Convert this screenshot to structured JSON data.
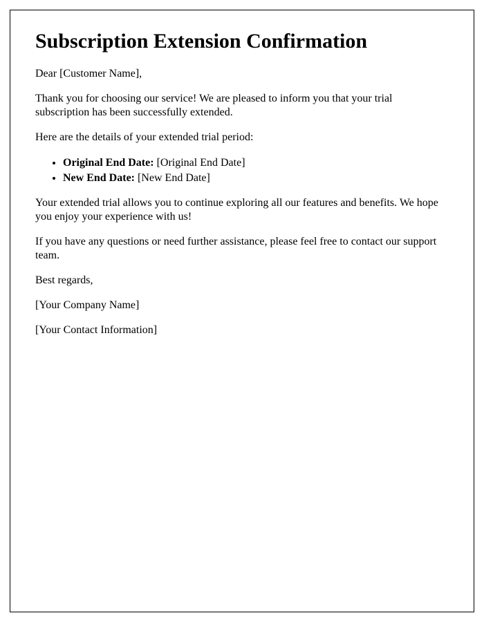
{
  "title": "Subscription Extension Confirmation",
  "greeting": "Dear [Customer Name],",
  "para1": "Thank you for choosing our service! We are pleased to inform you that your trial subscription has been successfully extended.",
  "para2": "Here are the details of your extended trial period:",
  "list": {
    "item1_label": "Original End Date:",
    "item1_value": " [Original End Date]",
    "item2_label": "New End Date:",
    "item2_value": " [New End Date]"
  },
  "para3": "Your extended trial allows you to continue exploring all our features and benefits. We hope you enjoy your experience with us!",
  "para4": "If you have any questions or need further assistance, please feel free to contact our support team.",
  "signoff": "Best regards,",
  "company": "[Your Company Name]",
  "contact": "[Your Contact Information]"
}
